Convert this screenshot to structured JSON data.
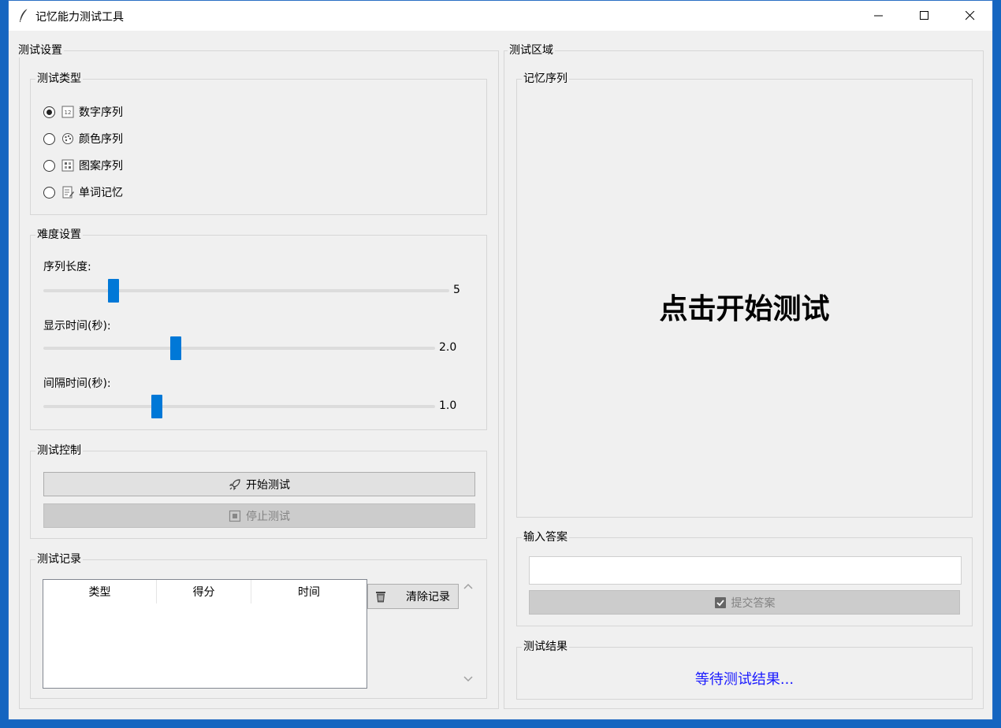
{
  "window": {
    "title": "记忆能力测试工具"
  },
  "settings": {
    "title": "测试设置",
    "test_type": {
      "title": "测试类型",
      "options": [
        {
          "label": "数字序列",
          "icon": "number-grid-icon",
          "checked": true
        },
        {
          "label": "颜色序列",
          "icon": "palette-icon",
          "checked": false
        },
        {
          "label": "图案序列",
          "icon": "pattern-grid-icon",
          "checked": false
        },
        {
          "label": "单词记忆",
          "icon": "memo-icon",
          "checked": false
        }
      ]
    },
    "difficulty": {
      "title": "难度设置",
      "sequence_length": {
        "label": "序列长度:",
        "value": "5"
      },
      "display_time": {
        "label": "显示时间(秒):",
        "value": "2.0"
      },
      "interval_time": {
        "label": "间隔时间(秒):",
        "value": "1.0"
      }
    },
    "control": {
      "title": "测试控制",
      "start_label": "开始测试",
      "stop_label": "停止测试"
    },
    "records": {
      "title": "测试记录",
      "columns": [
        "类型",
        "得分",
        "时间"
      ],
      "clear_label": "清除记录"
    }
  },
  "test_area": {
    "title": "测试区域",
    "sequence": {
      "title": "记忆序列",
      "prompt": "点击开始测试"
    },
    "answer": {
      "title": "输入答案",
      "value": "",
      "submit_label": "提交答案"
    },
    "result": {
      "title": "测试结果",
      "text": "等待测试结果...",
      "color": "#1a1aff"
    }
  },
  "colors": {
    "accent": "#0078d7",
    "taskbar": "#1565c0"
  }
}
